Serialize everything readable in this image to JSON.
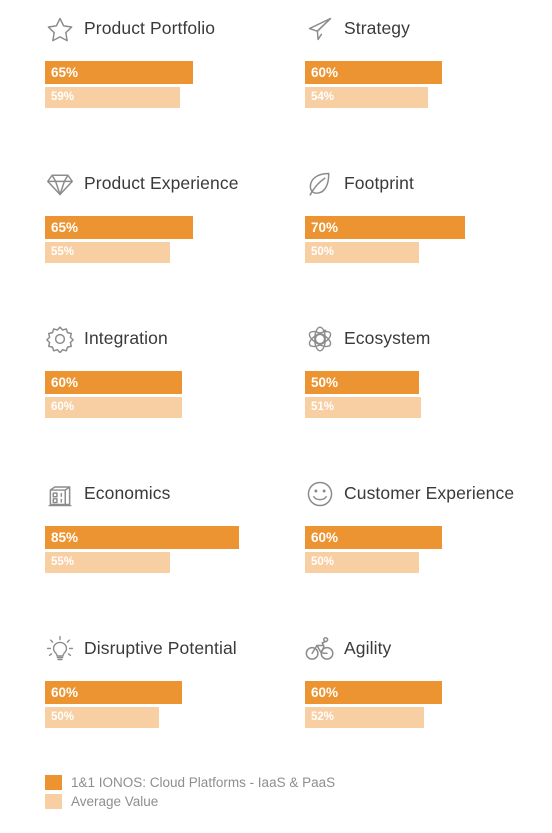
{
  "chart_data": {
    "type": "bar",
    "title": "",
    "subtitle": "",
    "xlabel": "",
    "ylabel": "",
    "xlim": [
      0,
      100
    ],
    "grid": false,
    "legend_position": "bottom-left",
    "orientation": "horizontal",
    "categories": [
      "Product Portfolio",
      "Strategy",
      "Product Experience",
      "Footprint",
      "Integration",
      "Ecosystem",
      "Economics",
      "Customer Experience",
      "Disruptive Potential",
      "Agility"
    ],
    "series": [
      {
        "name": "1&1 IONOS: Cloud Platforms - IaaS & PaaS",
        "color": "#ec9432",
        "values": [
          65,
          60,
          65,
          70,
          60,
          50,
          85,
          60,
          60,
          60
        ]
      },
      {
        "name": "Average Value",
        "color": "#f7cfa3",
        "values": [
          59,
          54,
          55,
          50,
          60,
          51,
          55,
          50,
          50,
          52
        ]
      }
    ]
  },
  "criteria": [
    {
      "label": "Product Portfolio",
      "icon": "star-icon",
      "primary_value": 65,
      "primary_label": "65%",
      "secondary_value": 59,
      "secondary_label": "59%"
    },
    {
      "label": "Strategy",
      "icon": "paper-plane-icon",
      "primary_value": 60,
      "primary_label": "60%",
      "secondary_value": 54,
      "secondary_label": "54%"
    },
    {
      "label": "Product Experience",
      "icon": "diamond-icon",
      "primary_value": 65,
      "primary_label": "65%",
      "secondary_value": 55,
      "secondary_label": "55%"
    },
    {
      "label": "Footprint",
      "icon": "leaf-icon",
      "primary_value": 70,
      "primary_label": "70%",
      "secondary_value": 50,
      "secondary_label": "50%"
    },
    {
      "label": "Integration",
      "icon": "gear-icon",
      "primary_value": 60,
      "primary_label": "60%",
      "secondary_value": 60,
      "secondary_label": "60%"
    },
    {
      "label": "Ecosystem",
      "icon": "atom-icon",
      "primary_value": 50,
      "primary_label": "50%",
      "secondary_value": 51,
      "secondary_label": "51%"
    },
    {
      "label": "Economics",
      "icon": "building-icon",
      "primary_value": 85,
      "primary_label": "85%",
      "secondary_value": 55,
      "secondary_label": "55%"
    },
    {
      "label": "Customer Experience",
      "icon": "smiley-icon",
      "primary_value": 60,
      "primary_label": "60%",
      "secondary_value": 50,
      "secondary_label": "50%"
    },
    {
      "label": "Disruptive Potential",
      "icon": "lightbulb-icon",
      "primary_value": 60,
      "primary_label": "60%",
      "secondary_value": 50,
      "secondary_label": "50%"
    },
    {
      "label": "Agility",
      "icon": "bicycle-icon",
      "primary_value": 60,
      "primary_label": "60%",
      "secondary_value": 52,
      "secondary_label": "52%"
    }
  ],
  "legend": {
    "items": [
      {
        "label": "1&1 IONOS: Cloud Platforms - IaaS & PaaS",
        "color": "#ec9432"
      },
      {
        "label": "Average Value",
        "color": "#f7cfa3"
      }
    ]
  },
  "colors": {
    "primary": "#ec9432",
    "secondary": "#f7cfa3",
    "icon": "#8c8c8c",
    "label_text": "#3a3a3a",
    "legend_text": "#8e8e8e",
    "background": "#ffffff"
  }
}
